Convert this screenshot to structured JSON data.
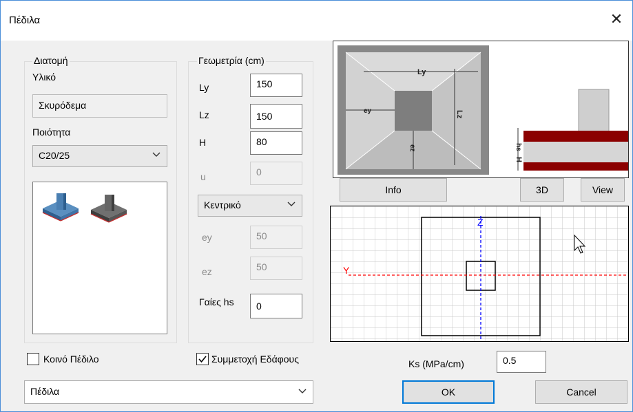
{
  "window": {
    "title": "Πέδιλα"
  },
  "section": {
    "legend": "Διατομή",
    "material_label": "Υλικό",
    "material_value": "Σκυρόδεμα",
    "quality_label": "Ποιότητα",
    "quality_value": "C20/25"
  },
  "geometry": {
    "legend": "Γεωμετρία (cm)",
    "ly_label": "Ly",
    "ly_value": "150",
    "lz_label": "Lz",
    "lz_value": "150",
    "h_label": "H",
    "h_value": "80",
    "u_label": "u",
    "u_value": "0",
    "position_value": "Κεντρικό",
    "ey_label": "ey",
    "ey_value": "50",
    "ez_label": "ez",
    "ez_value": "50",
    "hs_label": "Γαίες hs",
    "hs_value": "0"
  },
  "preview": {
    "plan_labels": {
      "ly": "Ly",
      "lz": "Lz",
      "ey": "ey",
      "ez": "ez"
    },
    "section_labels": {
      "hs": "hs",
      "h": "H"
    }
  },
  "buttons": {
    "info": "Info",
    "view3d": "3D",
    "view": "View",
    "ok": "OK",
    "cancel": "Cancel"
  },
  "grid": {
    "z_label": "Z",
    "y_label": "Y"
  },
  "options": {
    "common_footing_label": "Κοινό Πέδιλο",
    "common_footing_checked": false,
    "soil_participation_label": "Συμμετοχή Εδάφους",
    "soil_participation_checked": true
  },
  "ks": {
    "label": "Ks (MPa/cm)",
    "value": "0.5"
  },
  "type_select": {
    "value": "Πέδιλα"
  },
  "colors": {
    "accent": "#0078d7",
    "dark_red": "#8b0000",
    "axis_blue": "#0000ff",
    "axis_red": "#ff0000"
  }
}
